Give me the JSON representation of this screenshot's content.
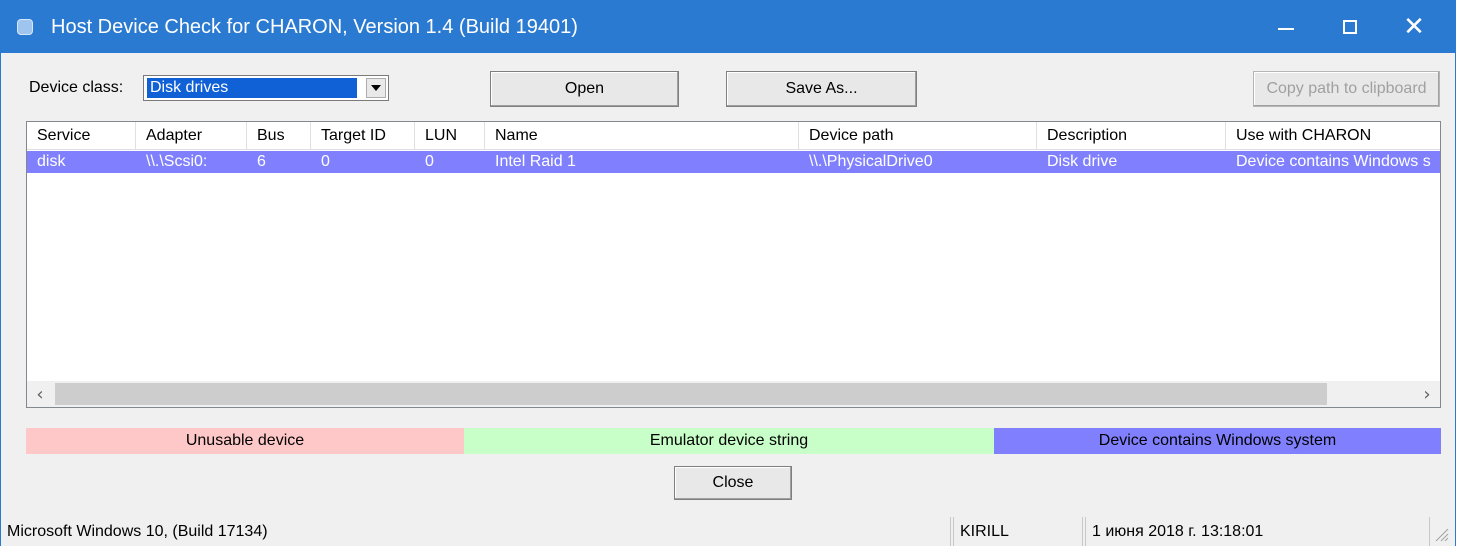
{
  "window": {
    "title": "Host Device Check for CHARON, Version 1.4 (Build 19401)"
  },
  "toolbar": {
    "device_class_label": "Device class:",
    "device_class_value": "Disk drives",
    "open_label": "Open",
    "save_as_label": "Save As...",
    "copy_path_label": "Copy path to clipboard"
  },
  "list": {
    "columns": [
      "Service",
      "Adapter",
      "Bus",
      "Target ID",
      "LUN",
      "Name",
      "Device path",
      "Description",
      "Use with CHARON"
    ],
    "rows": [
      [
        "disk",
        "\\\\.\\Scsi0:",
        "6",
        "0",
        "0",
        "Intel Raid 1",
        "\\\\.\\PhysicalDrive0",
        "Disk drive",
        "Device contains Windows s"
      ]
    ]
  },
  "legend": {
    "unusable": "Unusable device",
    "emulator": "Emulator device string",
    "windows": "Device contains Windows system"
  },
  "close_label": "Close",
  "statusbar": {
    "os": "Microsoft Windows 10,  (Build 17134)",
    "host": "KIRILL",
    "datetime": "1 июня 2018 г. 13:18:01"
  },
  "colors": {
    "titlebar": "#2b7ad2",
    "selected_row": "#8080ff",
    "unusable": "#ffc8c8",
    "emulator": "#c8ffc8",
    "windows_system": "#8080ff"
  }
}
